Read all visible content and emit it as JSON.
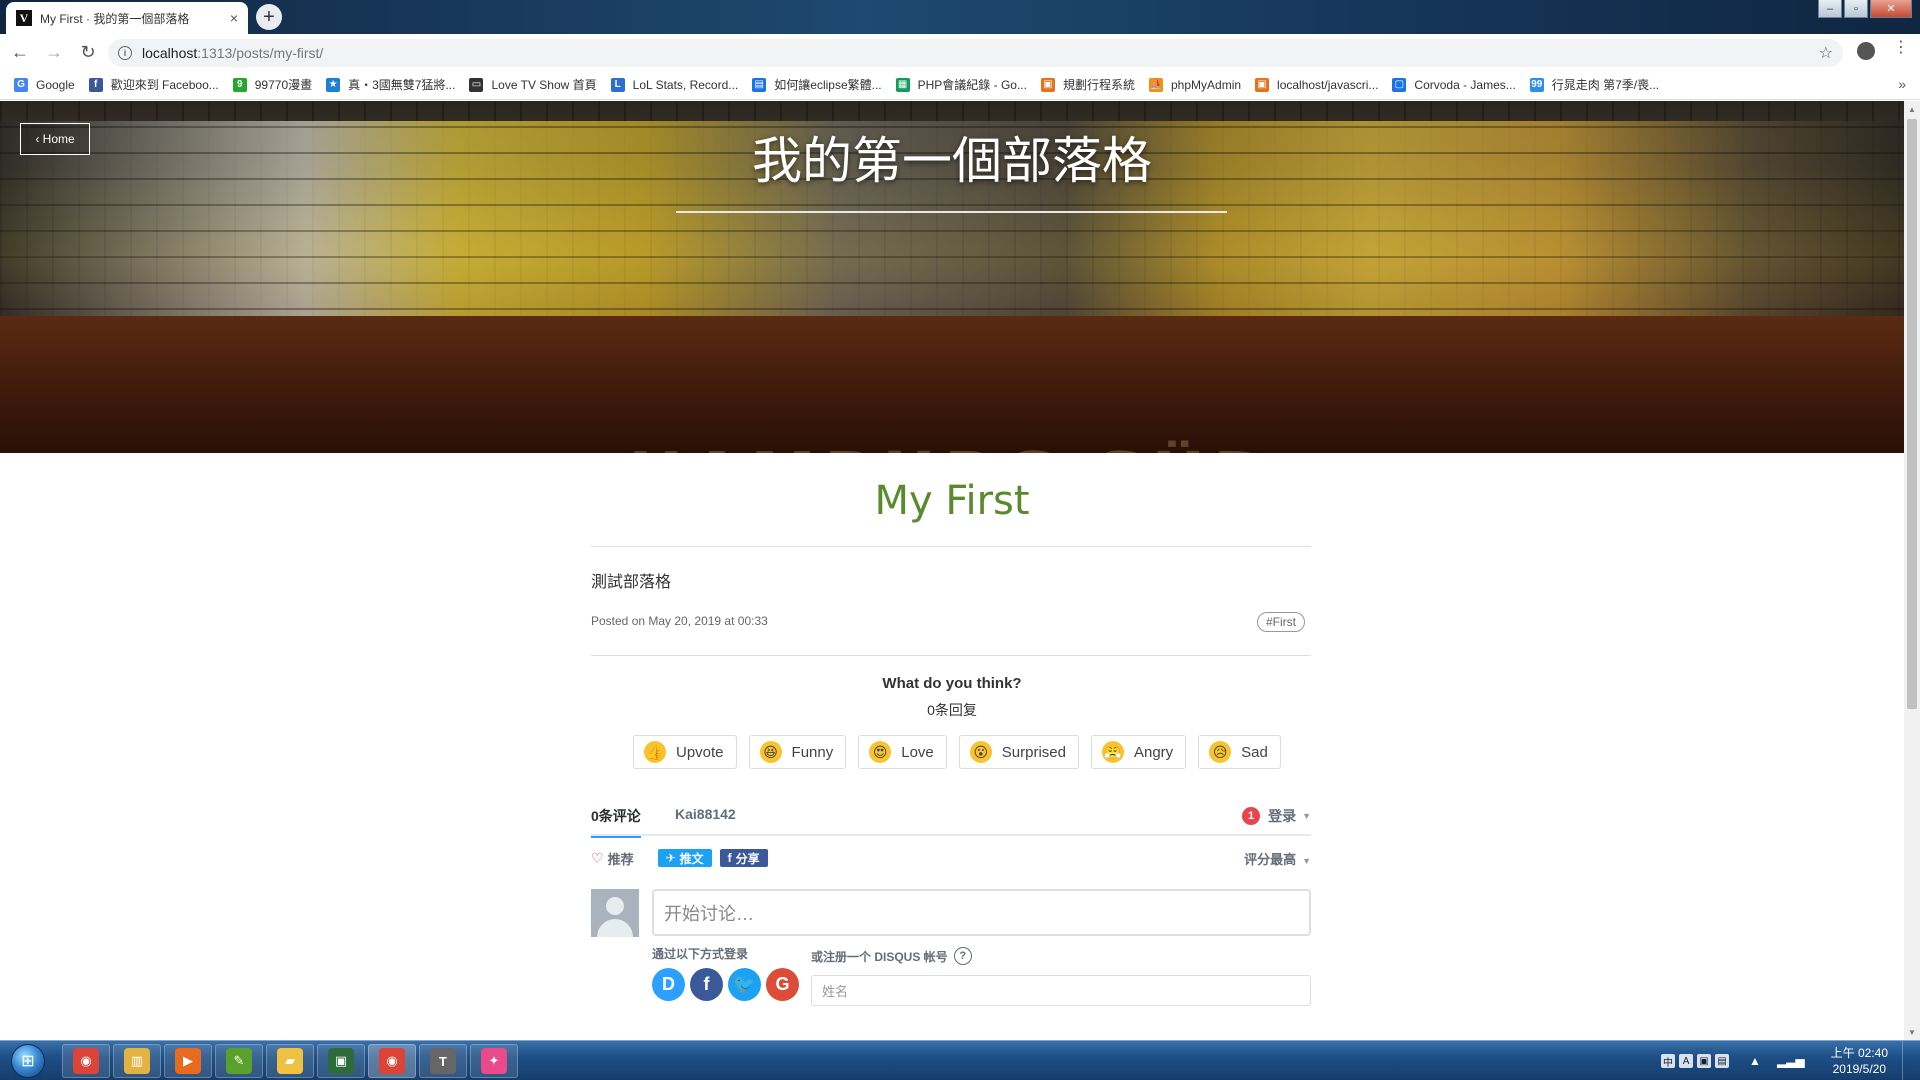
{
  "browser": {
    "tab_title": "My First · 我的第一個部落格",
    "tab_close": "×",
    "new_tab": "+",
    "url_host": "localhost",
    "url_path": ":1313/posts/my-first/",
    "bookmarks": [
      {
        "label": "Google",
        "color": "#4285f4",
        "icon": "G"
      },
      {
        "label": "歡迎來到 Faceboo...",
        "color": "#3b5998",
        "icon": "f"
      },
      {
        "label": "99770漫畫",
        "color": "#27a52d",
        "icon": "9"
      },
      {
        "label": "真・3國無雙7猛將...",
        "color": "#1e7fd6",
        "icon": "★"
      },
      {
        "label": "Love TV Show 首頁",
        "color": "#333333",
        "icon": "▭"
      },
      {
        "label": "LoL Stats, Record...",
        "color": "#2a6fd1",
        "icon": "L"
      },
      {
        "label": "如何讓eclipse繁體...",
        "color": "#1a73e8",
        "icon": "▤"
      },
      {
        "label": "PHP會議紀錄 - Go...",
        "color": "#0f9d58",
        "icon": "▦"
      },
      {
        "label": "規劃行程系統",
        "color": "#e8711b",
        "icon": "▣"
      },
      {
        "label": "phpMyAdmin",
        "color": "#f29111",
        "icon": "⛵"
      },
      {
        "label": "localhost/javascri...",
        "color": "#e8711b",
        "icon": "▣"
      },
      {
        "label": "Corvoda - James...",
        "color": "#1a73e8",
        "icon": "▢"
      },
      {
        "label": "行晁走肉 第7季/喪...",
        "color": "#2d8cf0",
        "icon": "99"
      }
    ],
    "bookmarks_more": "»"
  },
  "hero": {
    "home_label": "‹ Home",
    "title": "我的第一個部落格",
    "ship_text": "HAMBURG SÜD"
  },
  "post": {
    "title": "My First",
    "body": "測試部落格",
    "meta": "Posted on May 20, 2019 at 00:33",
    "tag": "#First"
  },
  "disqus": {
    "question": "What do you think?",
    "responses": "0条回复",
    "reactions": [
      {
        "label": "Upvote",
        "emoji": "👍"
      },
      {
        "label": "Funny",
        "emoji": "😆"
      },
      {
        "label": "Love",
        "emoji": "😍"
      },
      {
        "label": "Surprised",
        "emoji": "😮"
      },
      {
        "label": "Angry",
        "emoji": "😤"
      },
      {
        "label": "Sad",
        "emoji": "😥"
      }
    ],
    "tab_comments": "0条评论",
    "tab_site": "Kai88142",
    "login_badge": "1",
    "login_label": "登录",
    "recommend_label": "推荐",
    "tweet_label": "推文",
    "share_label": "分享",
    "sort_label": "评分最高",
    "comment_placeholder": "开始讨论…",
    "login_with_label": "通过以下方式登录",
    "signup_label": "或注册一个 DISQUS 帐号",
    "name_placeholder": "姓名",
    "social": [
      {
        "name": "disqus",
        "glyph": "D"
      },
      {
        "name": "facebook",
        "glyph": "f"
      },
      {
        "name": "twitter",
        "glyph": "🐦"
      },
      {
        "name": "google",
        "glyph": "G"
      }
    ]
  },
  "taskbar": {
    "apps": [
      {
        "name": "chrome",
        "glyph": "◉",
        "color": "#db4437"
      },
      {
        "name": "explorer",
        "glyph": "▥",
        "color": "#e3b341"
      },
      {
        "name": "media-player",
        "glyph": "▶",
        "color": "#e86a1e"
      },
      {
        "name": "notes",
        "glyph": "✎",
        "color": "#5aa02c"
      },
      {
        "name": "folder",
        "glyph": "▰",
        "color": "#f0c040"
      },
      {
        "name": "monitor",
        "glyph": "▣",
        "color": "#2f6b3a"
      },
      {
        "name": "chrome-active",
        "glyph": "◉",
        "color": "#db4437"
      },
      {
        "name": "typora",
        "glyph": "T",
        "color": "#666666"
      },
      {
        "name": "pinwheel",
        "glyph": "✦",
        "color": "#e94b8a"
      }
    ],
    "tray": [
      "中",
      "A",
      "▣",
      "▤"
    ],
    "time": "上午 02:40",
    "date": "2019/5/20"
  }
}
